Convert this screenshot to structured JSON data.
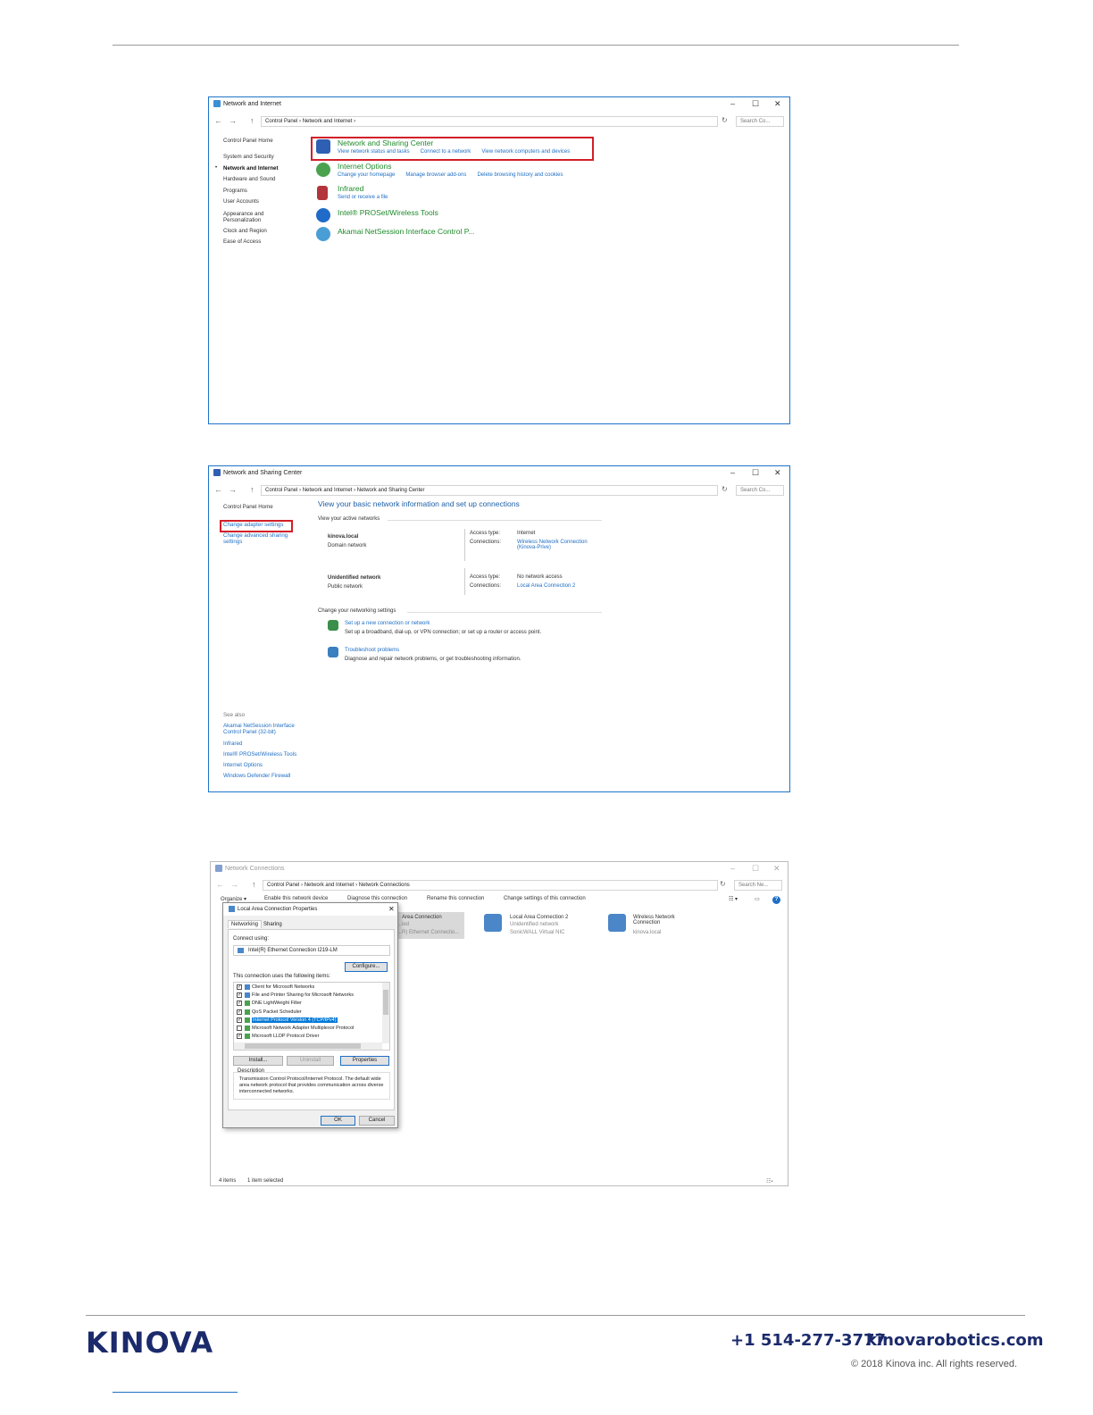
{
  "win1": {
    "title": "Network and Internet",
    "breadcrumb": [
      "Control Panel",
      "Network and Internet"
    ],
    "search": "Search Co...",
    "sidebar": [
      "Control Panel Home",
      "System and Security",
      "Network and Internet",
      "Hardware and Sound",
      "Programs",
      "User Accounts",
      "Appearance and Personalization",
      "Clock and Region",
      "Ease of Access"
    ],
    "categories": [
      {
        "title": "Network and Sharing Center",
        "links": [
          "View network status and tasks",
          "Connect to a network",
          "View network computers and devices"
        ]
      },
      {
        "title": "Internet Options",
        "links": [
          "Change your homepage",
          "Manage browser add-ons",
          "Delete browsing history and cookies"
        ]
      },
      {
        "title": "Infrared",
        "links": [
          "Send or receive a file"
        ]
      },
      {
        "title": "Intel® PROSet/Wireless Tools",
        "links": []
      },
      {
        "title": "Akamai NetSession Interface Control P...",
        "links": []
      }
    ]
  },
  "win2": {
    "title": "Network and Sharing Center",
    "breadcrumb": [
      "Control Panel",
      "Network and Internet",
      "Network and Sharing Center"
    ],
    "search": "Search Co...",
    "sidebar": [
      "Control Panel Home",
      "Change adapter settings",
      "Change advanced sharing settings"
    ],
    "heading": "View your basic network information and set up connections",
    "active_label": "View your active networks",
    "networks": [
      {
        "name": "kinova.local",
        "type": "Domain network",
        "access_label": "Access type:",
        "access": "Internet",
        "conn_label": "Connections:",
        "conn": "Wireless Network Connection (Kinova-Prive)"
      },
      {
        "name": "Unidentified network",
        "type": "Public network",
        "access_label": "Access type:",
        "access": "No network access",
        "conn_label": "Connections:",
        "conn": "Local Area Connection 2"
      }
    ],
    "change_label": "Change your networking settings",
    "tasks": [
      {
        "link": "Set up a new connection or network",
        "desc": "Set up a broadband, dial-up, or VPN connection; or set up a router or access point."
      },
      {
        "link": "Troubleshoot problems",
        "desc": "Diagnose and repair network problems, or get troubleshooting information."
      }
    ],
    "see_also": "See also",
    "see_also_items": [
      "Akamai NetSession Interface Control Panel (32-bit)",
      "Infrared",
      "Intel® PROSet/Wireless Tools",
      "Internet Options",
      "Windows Defender Firewall"
    ]
  },
  "win3": {
    "title": "Network Connections",
    "breadcrumb": [
      "Control Panel",
      "Network and Internet",
      "Network Connections"
    ],
    "search": "Search Ne...",
    "toolbar": [
      "Organize ▾",
      "Enable this network device",
      "Diagnose this connection",
      "Rename this connection",
      "Change settings of this connection"
    ],
    "adapters": [
      {
        "name": "Area Connection",
        "l2": "...led",
        "l3": "...R) Ethernet Connectio..."
      },
      {
        "name": "Local Area Connection 2",
        "l2": "Unidentified network",
        "l3": "SonicWALL Virtual NIC"
      },
      {
        "name": "Wireless Network Connection",
        "l2": "kinova.local",
        "l3": ""
      }
    ],
    "status": [
      "4 items",
      "1 item selected"
    ]
  },
  "dialog": {
    "title": "Local Area Connection Properties",
    "tabs": [
      "Networking",
      "Sharing"
    ],
    "connect_using": "Connect using:",
    "adapter": "Intel(R) Ethernet Connection I219-LM",
    "configure": "Configure...",
    "items_label": "This connection uses the following items:",
    "items": [
      {
        "label": "Client for Microsoft Networks",
        "checked": true
      },
      {
        "label": "File and Printer Sharing for Microsoft Networks",
        "checked": true
      },
      {
        "label": "DNE LightWeight Filter",
        "checked": true
      },
      {
        "label": "QoS Packet Scheduler",
        "checked": true
      },
      {
        "label": "Internet Protocol Version 4 (TCP/IPv4)",
        "checked": true,
        "selected": true
      },
      {
        "label": "Microsoft Network Adapter Multiplexor Protocol",
        "checked": false
      },
      {
        "label": "Microsoft LLDP Protocol Driver",
        "checked": true
      }
    ],
    "install": "Install...",
    "uninstall": "Uninstall",
    "properties": "Properties",
    "desc_label": "Description",
    "description": "Transmission Control Protocol/Internet Protocol. The default wide area network protocol that provides communication across diverse interconnected networks.",
    "ok": "OK",
    "cancel": "Cancel"
  },
  "footer": {
    "logo": "KINOVA",
    "phone": "+1 514-277-3777",
    "site": "kinovarobotics.com",
    "copyright": "© 2018 Kinova inc. All rights reserved."
  }
}
